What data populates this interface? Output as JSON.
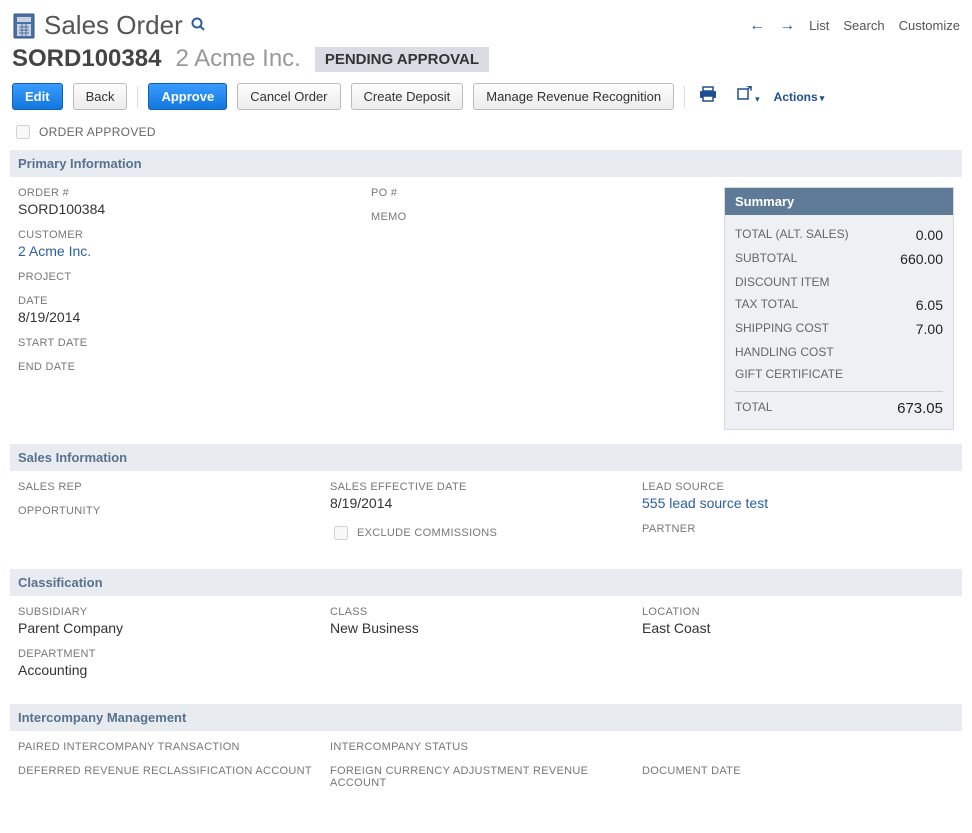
{
  "header": {
    "title": "Sales Order",
    "nav": {
      "list": "List",
      "search": "Search",
      "customize": "Customize"
    }
  },
  "record": {
    "id": "SORD100384",
    "customer": "2 Acme Inc.",
    "status": "PENDING APPROVAL"
  },
  "buttons": {
    "edit": "Edit",
    "back": "Back",
    "approve": "Approve",
    "cancel_order": "Cancel Order",
    "create_deposit": "Create Deposit",
    "manage_revenue": "Manage Revenue Recognition",
    "actions": "Actions"
  },
  "flags": {
    "order_approved_label": "ORDER APPROVED"
  },
  "sections": {
    "primary": {
      "title": "Primary Information",
      "order_num_label": "ORDER #",
      "order_num": "SORD100384",
      "customer_label": "CUSTOMER",
      "customer": "2 Acme Inc.",
      "project_label": "PROJECT",
      "project": "",
      "date_label": "DATE",
      "date": "8/19/2014",
      "start_date_label": "START DATE",
      "start_date": "",
      "end_date_label": "END DATE",
      "end_date": "",
      "po_label": "PO #",
      "po": "",
      "memo_label": "MEMO",
      "memo": ""
    },
    "summary": {
      "title": "Summary",
      "rows": {
        "total_alt_label": "TOTAL (ALT. SALES)",
        "total_alt": "0.00",
        "subtotal_label": "SUBTOTAL",
        "subtotal": "660.00",
        "discount_label": "DISCOUNT ITEM",
        "discount": "",
        "tax_label": "TAX TOTAL",
        "tax": "6.05",
        "shipping_label": "SHIPPING COST",
        "shipping": "7.00",
        "handling_label": "HANDLING COST",
        "handling": "",
        "gift_label": "GIFT CERTIFICATE",
        "gift": "",
        "total_label": "TOTAL",
        "total": "673.05"
      }
    },
    "sales_info": {
      "title": "Sales Information",
      "sales_rep_label": "SALES REP",
      "sales_rep": "",
      "opportunity_label": "OPPORTUNITY",
      "opportunity": "",
      "effective_date_label": "SALES EFFECTIVE DATE",
      "effective_date": "8/19/2014",
      "exclude_comm_label": "EXCLUDE COMMISSIONS",
      "lead_source_label": "LEAD SOURCE",
      "lead_source": "555 lead source test",
      "partner_label": "PARTNER",
      "partner": ""
    },
    "classification": {
      "title": "Classification",
      "subsidiary_label": "SUBSIDIARY",
      "subsidiary": "Parent Company",
      "department_label": "DEPARTMENT",
      "department": "Accounting",
      "class_label": "CLASS",
      "class": "New Business",
      "location_label": "LOCATION",
      "location": "East Coast"
    },
    "intercompany": {
      "title": "Intercompany Management",
      "paired_label": "PAIRED INTERCOMPANY TRANSACTION",
      "status_label": "INTERCOMPANY STATUS",
      "deferred_label": "DEFERRED REVENUE RECLASSIFICATION ACCOUNT",
      "fx_label": "FOREIGN CURRENCY ADJUSTMENT REVENUE ACCOUNT",
      "doc_date_label": "DOCUMENT DATE"
    }
  }
}
